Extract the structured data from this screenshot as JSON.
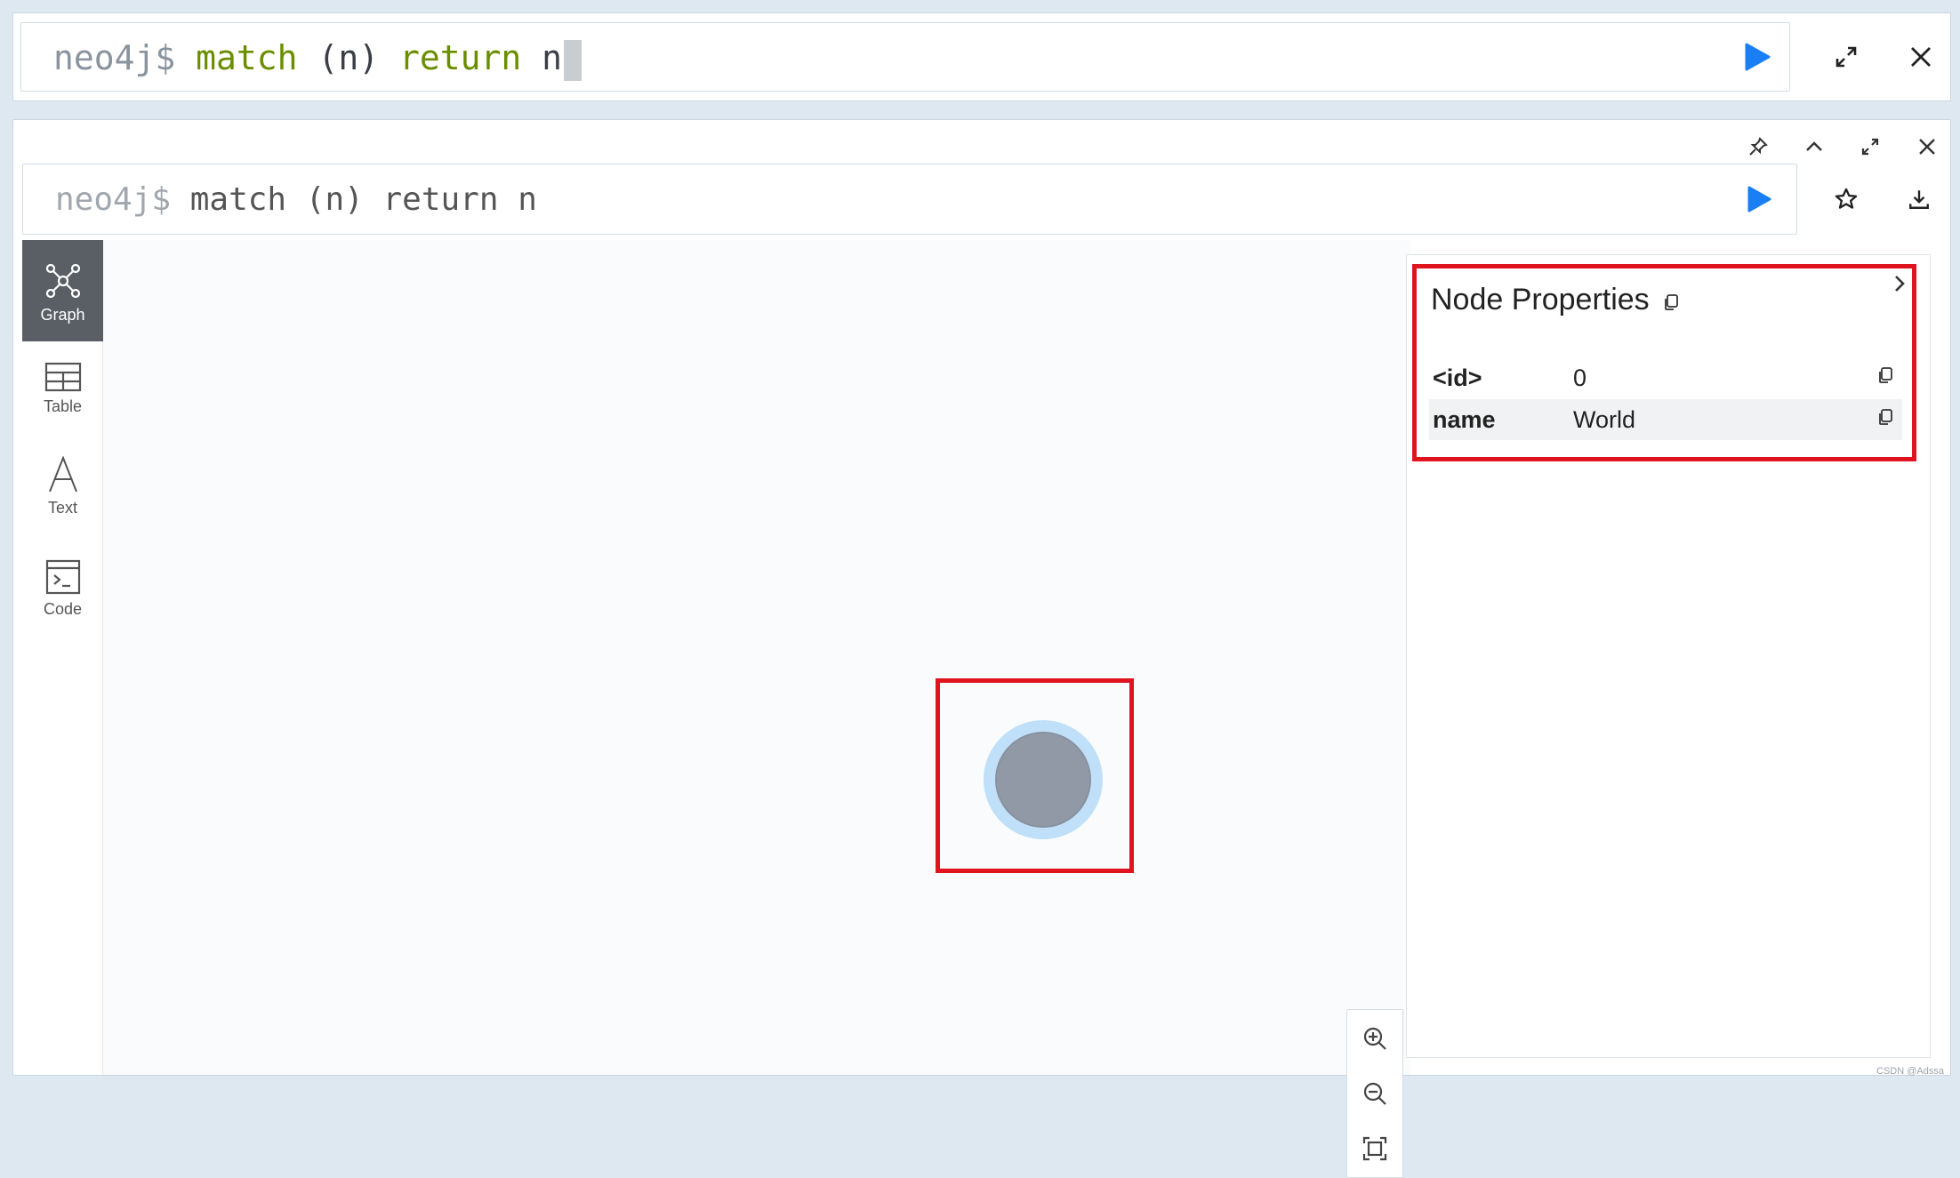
{
  "top_editor": {
    "prompt": "neo4j$",
    "keyword1": "match",
    "middle": "(n)",
    "keyword2": "return",
    "rest": "n"
  },
  "frame": {
    "query_prompt": "neo4j$",
    "query": "match (n) return n"
  },
  "sidebar": {
    "items": [
      {
        "label": "Graph",
        "icon": "graph-icon",
        "active": true
      },
      {
        "label": "Table",
        "icon": "table-icon",
        "active": false
      },
      {
        "label": "Text",
        "icon": "text-icon",
        "active": false
      },
      {
        "label": "Code",
        "icon": "code-icon",
        "active": false
      }
    ]
  },
  "properties": {
    "title": "Node Properties",
    "rows": [
      {
        "key": "<id>",
        "value": "0"
      },
      {
        "key": "name",
        "value": "World"
      }
    ]
  },
  "colors": {
    "accent_blue": "#1a7ef5",
    "highlight_red": "#e0141e",
    "node_fill": "#9199a6",
    "node_halo": "#bfe0f8",
    "sidebar_active": "#5a5f66"
  },
  "watermark": "CSDN @Adssa"
}
